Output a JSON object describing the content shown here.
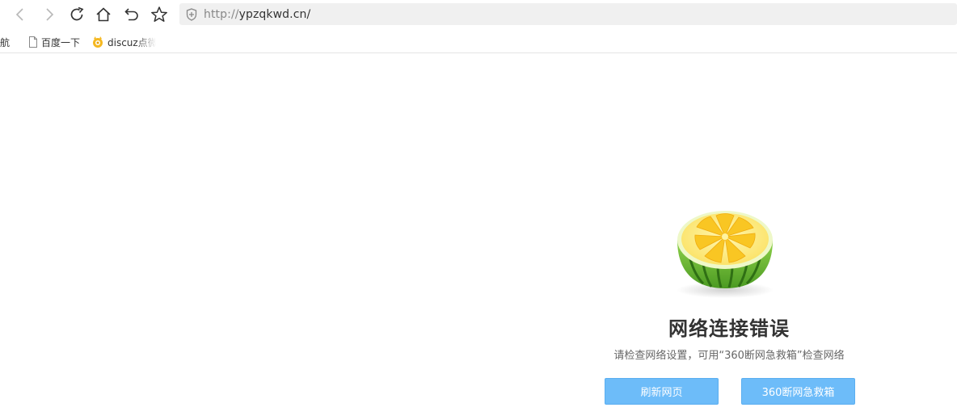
{
  "browser": {
    "url_protocol": "http://",
    "url_host": "ypzqkwd.cn/",
    "nav_icons": {
      "back": "chevron-left-icon",
      "forward": "chevron-right-icon",
      "reload": "reload-icon",
      "home": "home-icon",
      "undo": "undo-icon",
      "favorite": "star-icon",
      "security": "shield-icon"
    }
  },
  "bookmarks": [
    {
      "label": "导航"
    },
    {
      "label": "百度一下"
    },
    {
      "label": "discuz点微"
    }
  ],
  "error_page": {
    "title": "网络连接错误",
    "description": "请检查网络设置，可用“360断网急救箱”检查网络",
    "refresh_label": "刷新网页",
    "rescue_label": "360断网急救箱"
  },
  "colors": {
    "button": "#6dbcf9",
    "urlbar": "#f0f0f0",
    "lemon": "#f9c623",
    "rind": "#5aa829"
  }
}
